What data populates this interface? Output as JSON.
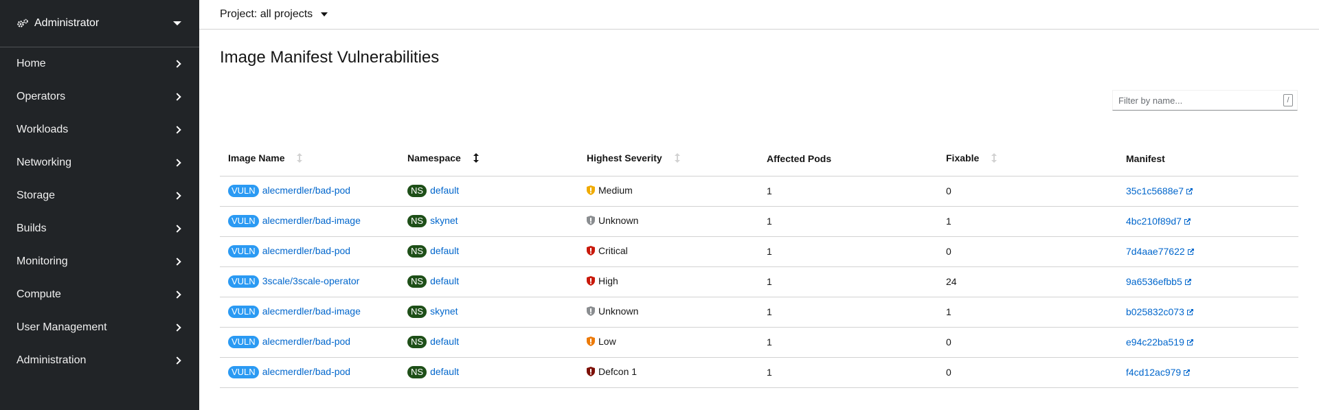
{
  "sidebar": {
    "perspective": "Administrator",
    "items": [
      {
        "label": "Home"
      },
      {
        "label": "Operators"
      },
      {
        "label": "Workloads"
      },
      {
        "label": "Networking"
      },
      {
        "label": "Storage"
      },
      {
        "label": "Builds"
      },
      {
        "label": "Monitoring"
      },
      {
        "label": "Compute"
      },
      {
        "label": "User Management"
      },
      {
        "label": "Administration"
      }
    ]
  },
  "project": {
    "label": "Project: all projects"
  },
  "page": {
    "title": "Image Manifest Vulnerabilities"
  },
  "filter": {
    "placeholder": "Filter by name...",
    "shortcut": "/"
  },
  "colors": {
    "link": "#0066cc",
    "vuln_badge": "#2b9af3",
    "ns_badge": "#1e4f18",
    "medium": "#f0ab00",
    "unknown": "#8a8d90",
    "critical": "#c9190b",
    "high": "#c9190b",
    "low": "#ec7a08",
    "defcon": "#7d1007"
  },
  "table": {
    "headers": [
      "Image Name",
      "Namespace",
      "Highest Severity",
      "Affected Pods",
      "Fixable",
      "Manifest"
    ],
    "vuln_badge": "VULN",
    "ns_badge": "NS",
    "rows": [
      {
        "image": "alecmerdler/bad-pod",
        "namespace": "default",
        "severity": "Medium",
        "severity_icon": "medium-severity-icon",
        "affected": "1",
        "fixable": "0",
        "manifest": "35c1c5688e7"
      },
      {
        "image": "alecmerdler/bad-image",
        "namespace": "skynet",
        "severity": "Unknown",
        "severity_icon": "unknown-severity-icon",
        "affected": "1",
        "fixable": "1",
        "manifest": "4bc210f89d7"
      },
      {
        "image": "alecmerdler/bad-pod",
        "namespace": "default",
        "severity": "Critical",
        "severity_icon": "critical-severity-icon",
        "affected": "1",
        "fixable": "0",
        "manifest": "7d4aae77622"
      },
      {
        "image": "3scale/3scale-operator",
        "namespace": "default",
        "severity": "High",
        "severity_icon": "high-severity-icon",
        "affected": "1",
        "fixable": "24",
        "manifest": "9a6536efbb5"
      },
      {
        "image": "alecmerdler/bad-image",
        "namespace": "skynet",
        "severity": "Unknown",
        "severity_icon": "unknown-severity-icon",
        "affected": "1",
        "fixable": "1",
        "manifest": "b025832c073"
      },
      {
        "image": "alecmerdler/bad-pod",
        "namespace": "default",
        "severity": "Low",
        "severity_icon": "low-severity-icon",
        "affected": "1",
        "fixable": "0",
        "manifest": "e94c22ba519"
      },
      {
        "image": "alecmerdler/bad-pod",
        "namespace": "default",
        "severity": "Defcon 1",
        "severity_icon": "defcon-severity-icon",
        "affected": "1",
        "fixable": "0",
        "manifest": "f4cd12ac979"
      }
    ]
  }
}
